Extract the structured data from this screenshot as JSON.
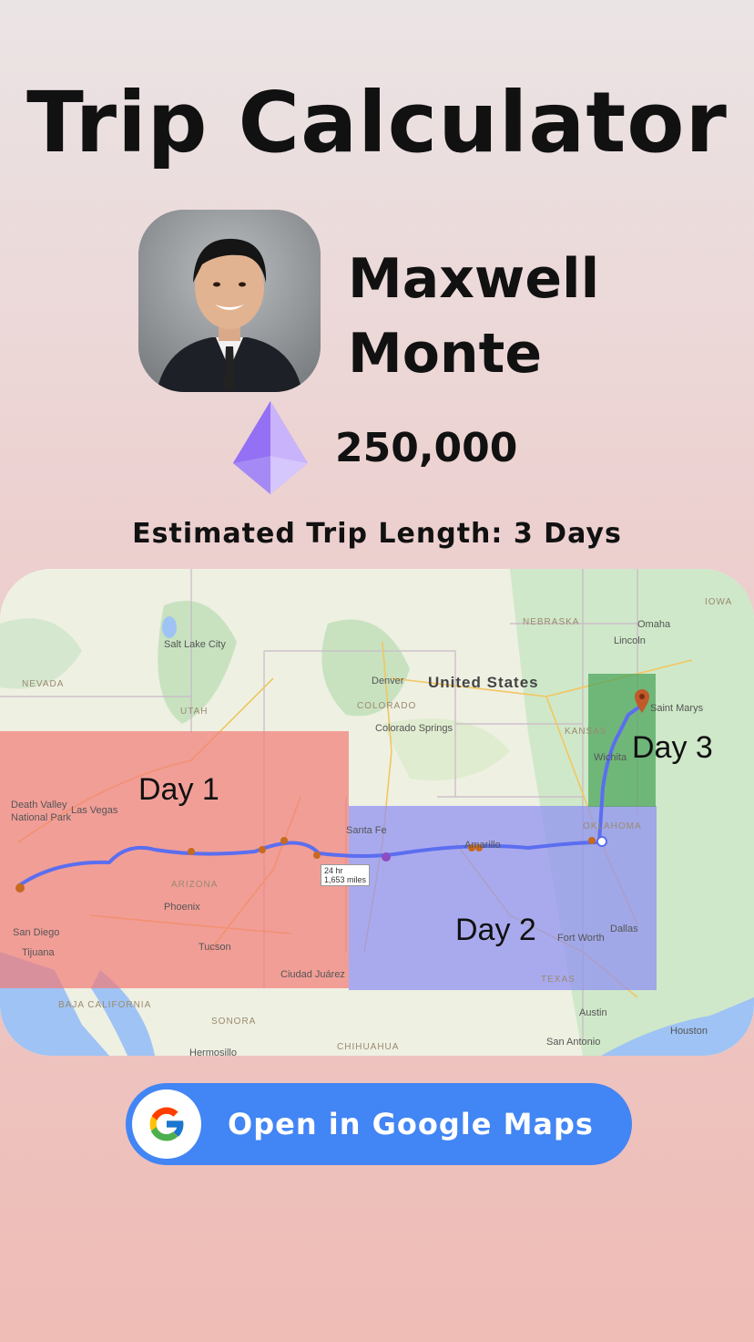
{
  "page": {
    "title": "Trip Calculator"
  },
  "profile": {
    "first_name": "Maxwell",
    "last_name": "Monte",
    "avatar_icon": "person-portrait-icon"
  },
  "points": {
    "icon": "purple-crystal-icon",
    "value": "250,000"
  },
  "trip": {
    "estimate_text": "Estimated Trip Length: 3 Days"
  },
  "map": {
    "country_label": "United States",
    "day_labels": [
      "Day 1",
      "Day 2",
      "Day 3"
    ],
    "route_badge_time": "24 hr",
    "route_badge_distance": "1,653 miles",
    "places": {
      "nevada": "NEVADA",
      "utah": "UTAH",
      "colorado": "COLORADO",
      "kansas": "KANSAS",
      "nebraska": "NEBRASKA",
      "iowa": "IOWA",
      "arizona": "ARIZONA",
      "oklahoma": "OKLAHOMA",
      "texas": "TEXAS",
      "baja": "BAJA CALIFORNIA",
      "sonora": "SONORA",
      "chihuahua": "CHIHUAHUA",
      "salt_lake": "Salt Lake City",
      "denver": "Denver",
      "las_vegas": "Las Vegas",
      "phoenix": "Phoenix",
      "tucson": "Tucson",
      "san_diego": "San Diego",
      "tijuana": "Tijuana",
      "santa_fe": "Santa Fe",
      "amarillo": "Amarillo",
      "dallas": "Dallas",
      "fort_worth": "Fort Worth",
      "austin": "Austin",
      "houston": "Houston",
      "san_antonio": "San Antonio",
      "ciudad_juarez": "Ciudad Juárez",
      "hermosillo": "Hermosillo",
      "saint_marys": "Saint Marys",
      "wichita": "Wichita",
      "lincoln": "Lincoln",
      "omaha": "Omaha",
      "colorado_springs": "Colorado Springs",
      "death_valley": "Death Valley National Park"
    },
    "colors": {
      "day1": "#f27a78",
      "day2": "#8f8ff2",
      "day3": "#4aa35a",
      "route": "#5b6ef0"
    }
  },
  "button": {
    "label": "Open in Google Maps",
    "icon": "google-g-icon",
    "color": "#4285f4"
  }
}
